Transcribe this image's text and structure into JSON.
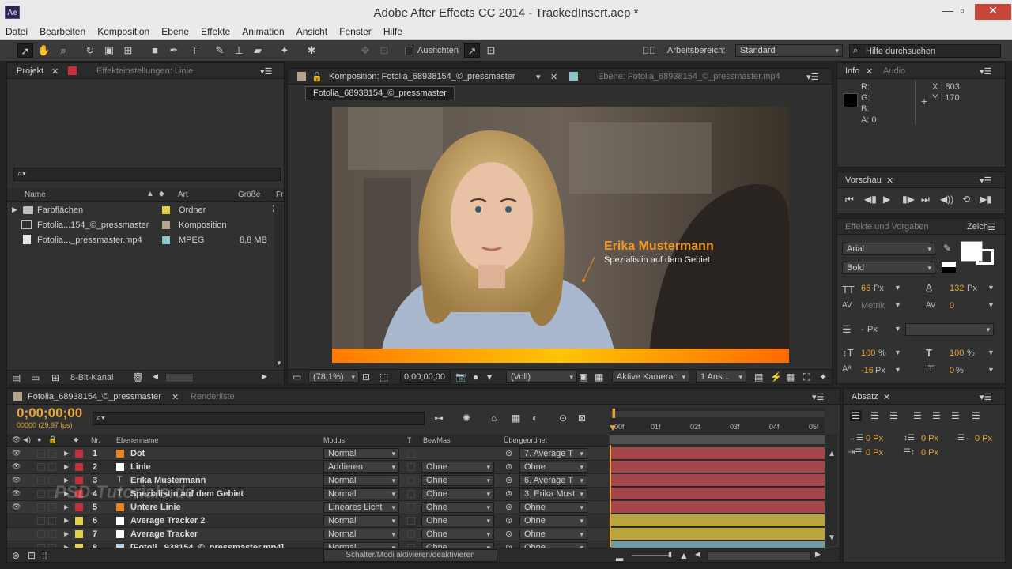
{
  "window": {
    "title": "Adobe After Effects CC 2014 - TrackedInsert.aep *",
    "app_badge": "Ae"
  },
  "menu": [
    "Datei",
    "Bearbeiten",
    "Komposition",
    "Ebene",
    "Effekte",
    "Animation",
    "Ansicht",
    "Fenster",
    "Hilfe"
  ],
  "toolbar": {
    "align_label": "Ausrichten",
    "workspace_label": "Arbeitsbereich:",
    "workspace_value": "Standard",
    "help_placeholder": "Hilfe durchsuchen"
  },
  "project_panel": {
    "tab": "Projekt",
    "tab2": "Effekteinstellungen: Linie",
    "columns": [
      "Name",
      "Art",
      "Größe",
      "Fr"
    ],
    "items": [
      {
        "name": "Farbflächen",
        "type": "Ordner",
        "size": "",
        "color": "#e3d247"
      },
      {
        "name": "Fotolia...154_©_pressmaster",
        "type": "Komposition",
        "size": "",
        "color": "#b3a58a"
      },
      {
        "name": "Fotolia..._pressmaster.mp4",
        "type": "MPEG",
        "size": "8,8 MB",
        "color": "#8fc5c8"
      }
    ],
    "footer_bitdepth": "8-Bit-Kanal"
  },
  "comp_panel": {
    "tab": "Komposition: Fotolia_68938154_©_pressmaster",
    "tab2": "Ebene: Fotolia_68938154_©_pressmaster.mp4",
    "breadcrumb": "Fotolia_68938154_©_pressmaster",
    "lower_third_name": "Erika Mustermann",
    "lower_third_sub": "Spezialistin auf dem Gebiet",
    "zoom": "(78,1%)",
    "timecode": "0;00;00;00",
    "resolution": "(Voll)",
    "camera": "Aktive Kamera",
    "views": "1 Ans..."
  },
  "info_panel": {
    "tab": "Info",
    "tab2": "Audio",
    "r": "R:",
    "g": "G:",
    "b": "B:",
    "a": "A:  0",
    "x": "X : 803",
    "y": "Y : 170"
  },
  "preview_panel": {
    "tab": "Vorschau"
  },
  "effects_panel": {
    "tab": "Effekte und Vorgaben",
    "tab2": "Zeich"
  },
  "char_panel": {
    "font": "Arial",
    "style": "Bold",
    "size": "66",
    "size_unit": "Px",
    "leading": "132",
    "leading_unit": "Px",
    "kerning": "Metrik",
    "tracking": "0",
    "stroke": "-",
    "stroke_unit": "Px",
    "vscale": "100",
    "vscale_unit": "%",
    "hscale": "100",
    "hscale_unit": "%",
    "baseline": "-16",
    "baseline_unit": "Px",
    "tsume": "0",
    "tsume_unit": "%"
  },
  "paragraph_panel": {
    "tab": "Absatz",
    "indent1": "0 Px",
    "indent2": "0 Px",
    "indent3": "0 Px",
    "space1": "0 Px",
    "space2": "0 Px"
  },
  "timeline": {
    "tab": "Fotolia_68938154_©_pressmaster",
    "tab2": "Renderliste",
    "timecode": "0;00;00;00",
    "fps": "00000 (29.97 fps)",
    "col_nr": "Nr.",
    "col_name": "Ebenenname",
    "col_mode": "Modus",
    "col_t": "T",
    "col_trkmat": "BewMas",
    "col_parent": "Übergeordnet",
    "ruler": [
      "00f",
      "01f",
      "02f",
      "03f",
      "04f",
      "05f"
    ],
    "layers": [
      {
        "nr": "1",
        "name": "Dot",
        "mode": "Normal",
        "trkmat": "",
        "parent": "7. Average T",
        "label": "#e8871e",
        "type": "solid"
      },
      {
        "nr": "2",
        "name": "Linie",
        "mode": "Addieren",
        "trkmat": "Ohne",
        "parent": "Ohne",
        "label": "#ffffff",
        "type": "solid"
      },
      {
        "nr": "3",
        "name": "Erika Mustermann",
        "mode": "Normal",
        "trkmat": "Ohne",
        "parent": "6. Average T",
        "label": "",
        "type": "text"
      },
      {
        "nr": "4",
        "name": "Spezialistin auf dem Gebiet",
        "mode": "Normal",
        "trkmat": "Ohne",
        "parent": "3. Erika Must",
        "label": "",
        "type": "text"
      },
      {
        "nr": "5",
        "name": "Untere Linie",
        "mode": "Lineares Licht",
        "trkmat": "Ohne",
        "parent": "Ohne",
        "label": "#e8871e",
        "type": "solid"
      },
      {
        "nr": "6",
        "name": "Average Tracker 2",
        "mode": "Normal",
        "trkmat": "Ohne",
        "parent": "Ohne",
        "label": "#ffffff",
        "type": "solid"
      },
      {
        "nr": "7",
        "name": "Average Tracker",
        "mode": "Normal",
        "trkmat": "Ohne",
        "parent": "Ohne",
        "label": "#ffffff",
        "type": "solid"
      },
      {
        "nr": "8",
        "name": "[Fotoli...938154_©_pressmaster.mp4]",
        "mode": "Normal",
        "trkmat": "Ohne",
        "parent": "Ohne",
        "label": "#bcd8e8",
        "type": "footage"
      }
    ],
    "toggle_label": "Schalter/Modi aktivieren/deaktivieren",
    "watermark": "PSD-Tutorials.de"
  }
}
